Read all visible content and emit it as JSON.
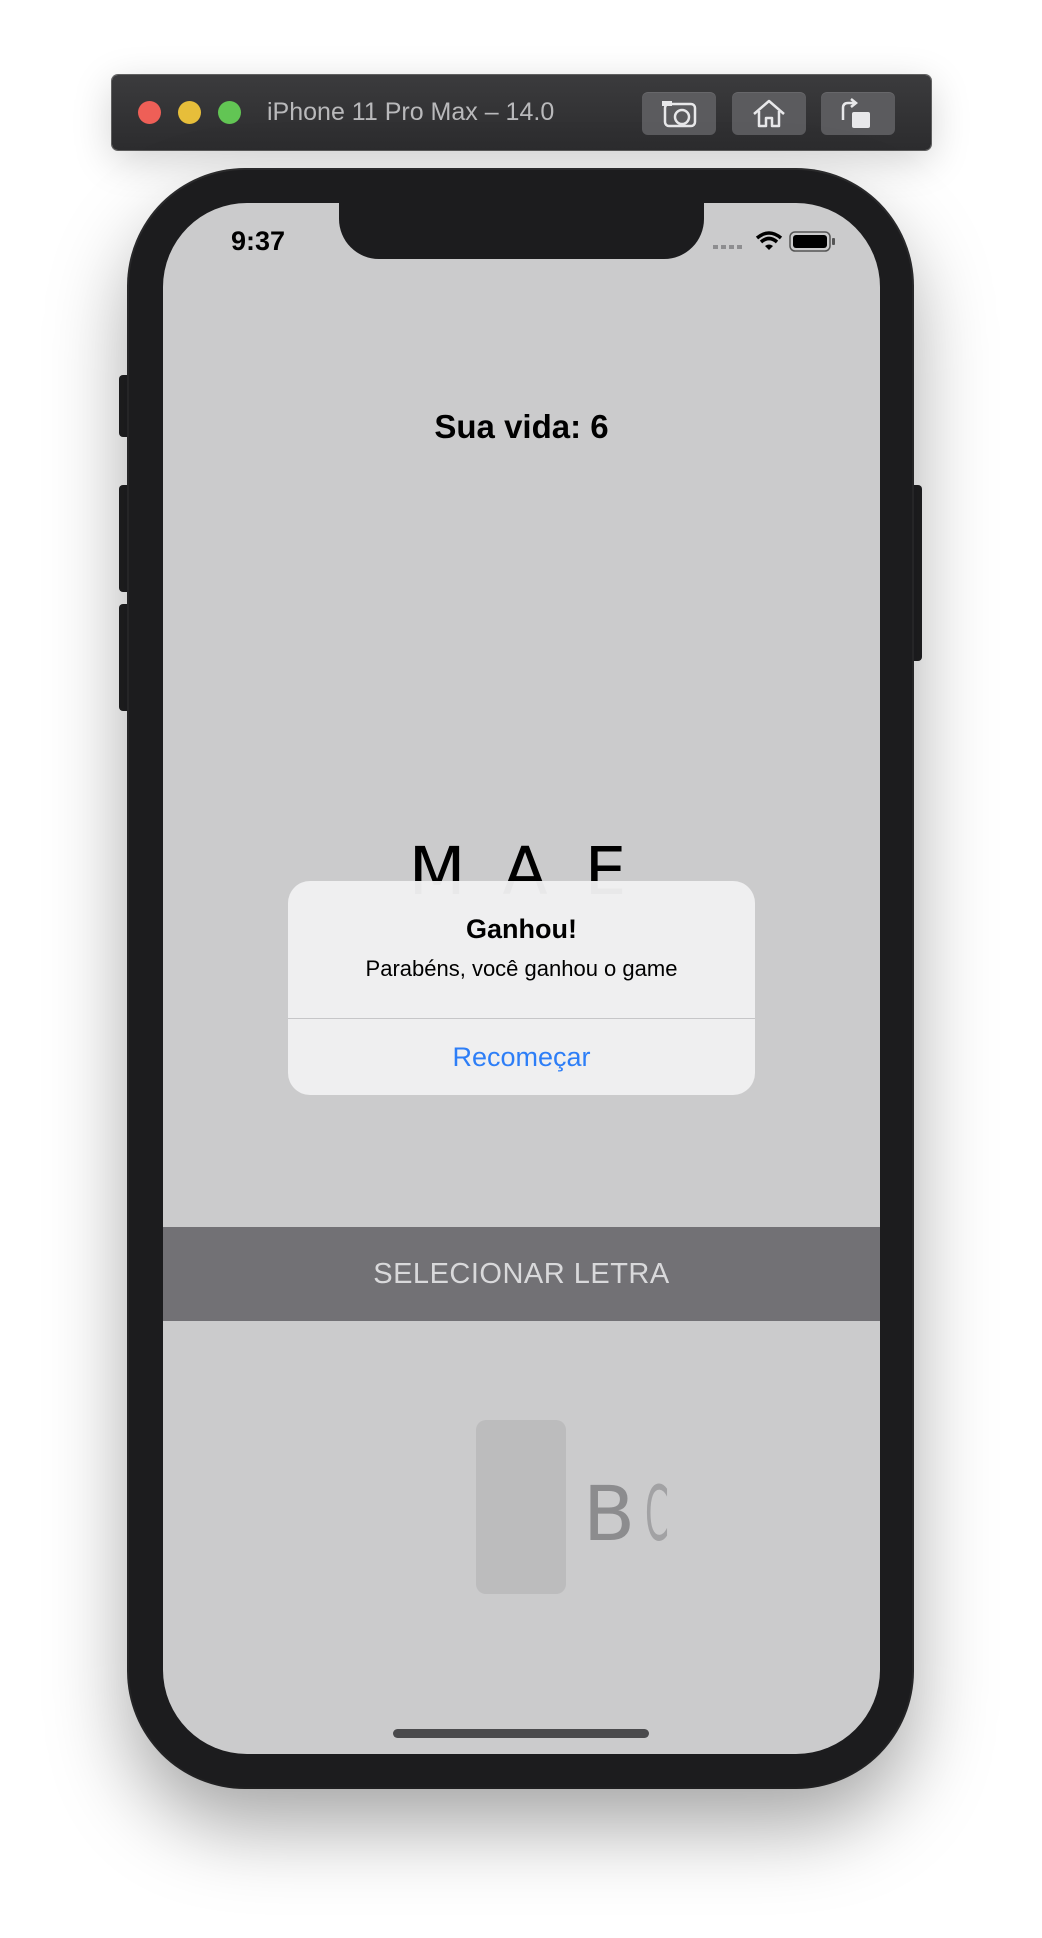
{
  "simulator": {
    "title": "iPhone 11 Pro Max – 14.0",
    "buttons": [
      {
        "name": "screenshot",
        "icon": "camera-icon"
      },
      {
        "name": "home",
        "icon": "home-icon"
      },
      {
        "name": "rotate",
        "icon": "rotate-icon"
      }
    ]
  },
  "status_bar": {
    "time": "9:37",
    "icons": [
      "signal-icon",
      "wifi-icon",
      "battery-icon"
    ]
  },
  "game": {
    "life_label": "Sua vida: 6",
    "word": "M A E"
  },
  "alert": {
    "title": "Ganhou!",
    "message": "Parabéns, você ganhou o game",
    "action_label": "Recomeçar",
    "action_color": "#2d7ef7"
  },
  "select_button": {
    "label": "SELECIONAR LETRA"
  },
  "picker": {
    "visible_letters": [
      "B",
      "C"
    ]
  },
  "colors": {
    "screen_background": "#cbcbcc",
    "select_bar": "#727175",
    "phone_body": "#1c1c1e"
  }
}
